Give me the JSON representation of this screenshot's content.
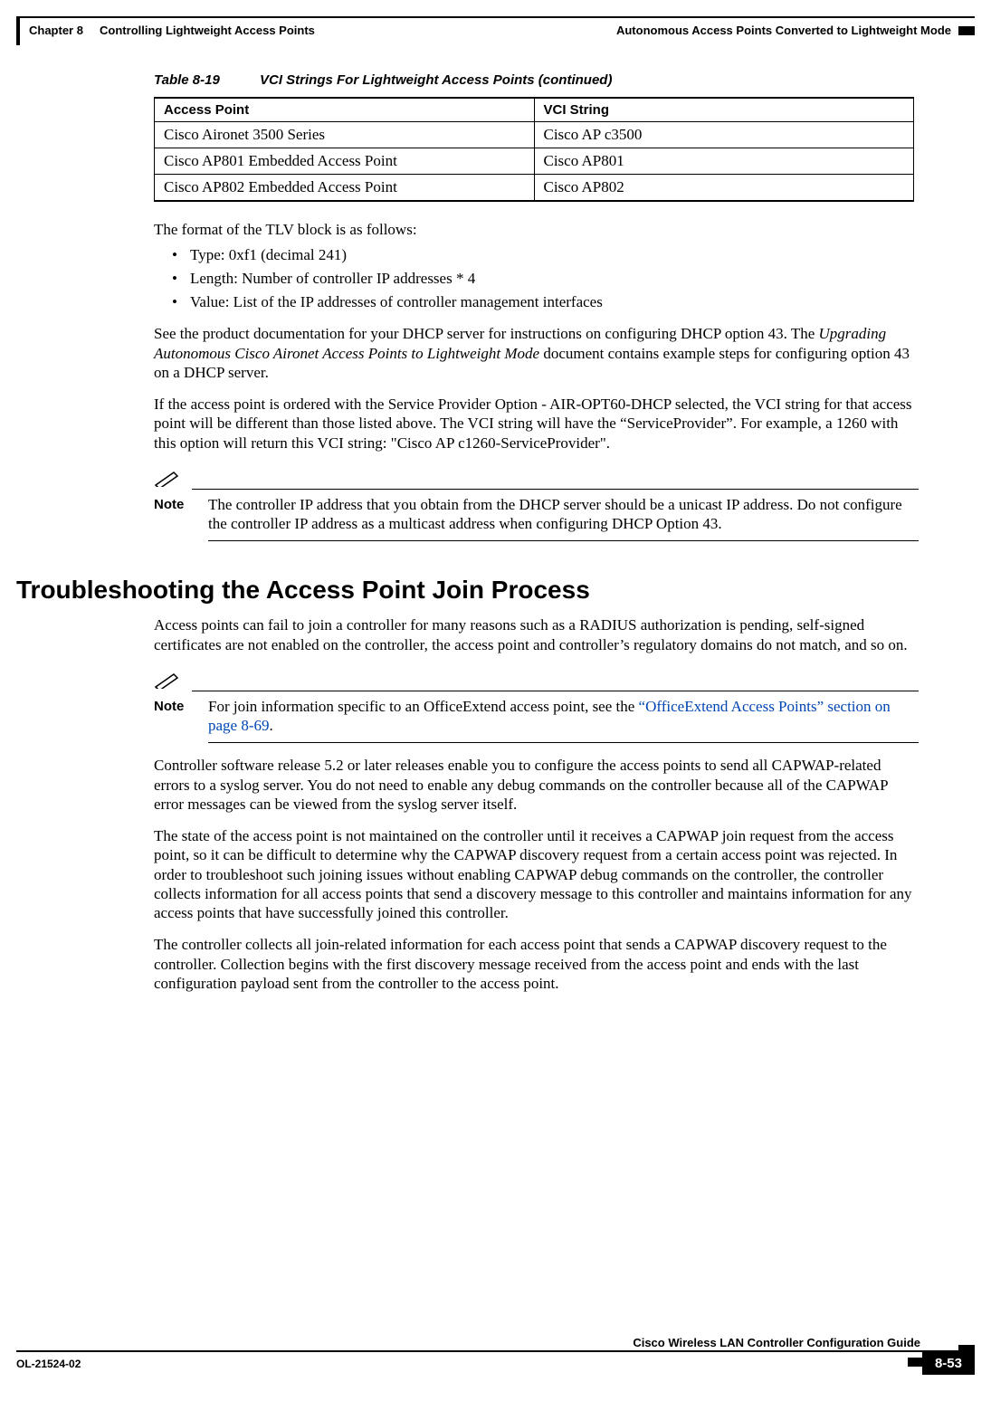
{
  "header": {
    "chapter": "Chapter 8",
    "chapter_title": "Controlling Lightweight Access Points",
    "right_text": "Autonomous Access Points Converted to Lightweight Mode"
  },
  "table": {
    "number": "Table 8-19",
    "title": "VCI Strings For Lightweight Access Points (continued)",
    "headers": {
      "col1": "Access Point",
      "col2": "VCI String"
    },
    "rows": [
      {
        "c1": "Cisco Aironet 3500 Series",
        "c2": "Cisco AP c3500"
      },
      {
        "c1": "Cisco AP801 Embedded Access Point",
        "c2": "Cisco AP801"
      },
      {
        "c1": "Cisco AP802 Embedded Access Point",
        "c2": "Cisco AP802"
      }
    ]
  },
  "paragraphs": {
    "tlv_intro": "The format of the TLV block is as follows:",
    "bullets": [
      "Type: 0xf1 (decimal 241)",
      "Length: Number of controller IP addresses * 4",
      "Value: List of the IP addresses of controller management interfaces"
    ],
    "dhcp_doc_pre": "See the product documentation for your DHCP server for instructions on configuring DHCP option 43. The ",
    "dhcp_doc_em": "Upgrading Autonomous Cisco Aironet Access Points to Lightweight Mode",
    "dhcp_doc_post": " document contains example steps for configuring option 43 on a DHCP server.",
    "sp_para": "If the access point is ordered with the Service Provider Option - AIR-OPT60-DHCP selected, the VCI string for that access point will be different than those listed above. The VCI string will have the “ServiceProvider”. For example, a 1260 with this option will return this VCI string: \"Cisco AP c1260-ServiceProvider\".",
    "note1_label": "Note",
    "note1_text": "The controller IP address that you obtain from the DHCP server should be a unicast IP address. Do not configure the controller IP address as a multicast address when configuring DHCP Option 43."
  },
  "section2": {
    "heading": "Troubleshooting the Access Point Join Process",
    "p1": "Access points can fail to join a controller for many reasons such as a RADIUS authorization is pending, self-signed certificates are not enabled on the controller, the access point and controller’s regulatory domains do not match, and so on.",
    "note_label": "Note",
    "note_text_pre": "For join information specific to an OfficeExtend access point, see the ",
    "note_link": "“OfficeExtend Access Points” section on page 8-69",
    "note_text_post": ".",
    "p2": "Controller software release 5.2 or later releases enable you to configure the access points to send all CAPWAP-related errors to a syslog server. You do not need to enable any debug commands on the controller because all of the CAPWAP error messages can be viewed from the syslog server itself.",
    "p3": "The state of the access point is not maintained on the controller until it receives a CAPWAP join request from the access point, so it can be difficult to determine why the CAPWAP discovery request from a certain access point was rejected. In order to troubleshoot such joining issues without enabling CAPWAP debug commands on the controller, the controller collects information for all access points that send a discovery message to this controller and maintains information for any access points that have successfully joined this controller.",
    "p4": "The controller collects all join-related information for each access point that sends a CAPWAP discovery request to the controller. Collection begins with the first discovery message received from the access point and ends with the last configuration payload sent from the controller to the access point."
  },
  "footer": {
    "guide_title": "Cisco Wireless LAN Controller Configuration Guide",
    "ol": "OL-21524-02",
    "page": "8-53"
  }
}
